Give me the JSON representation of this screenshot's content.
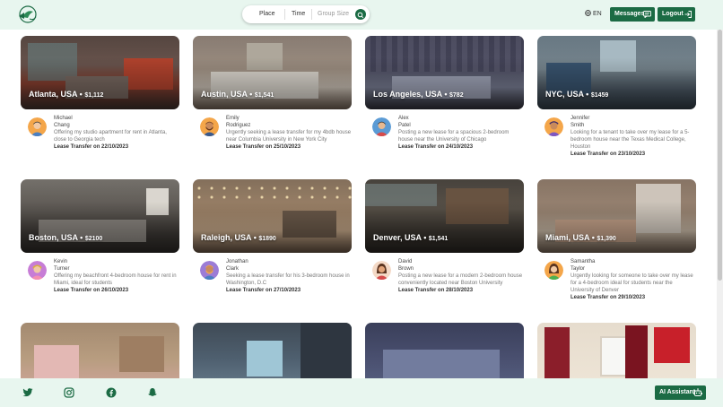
{
  "header": {
    "search": {
      "place": "Place",
      "time": "Time",
      "group_size": "Group Size"
    },
    "language": "EN",
    "messages_label": "Messages",
    "logout_label": "Logout"
  },
  "listings": [
    {
      "city": "Atlanta, USA",
      "price": "$1,112",
      "first_name": "Michael",
      "last_name": "Chang",
      "description": "Offering my studio apartment for rent in Atlanta, close to Georgia tech",
      "lease": "Lease Transfer on 22/10/2023"
    },
    {
      "city": "Austin, USA",
      "price": "$1,541",
      "first_name": "Emily",
      "last_name": "Rodriguez",
      "description": "Urgently seeking a lease transfer for my 4bdb house near Columbia University in New York City",
      "lease": "Lease Transfer on 25/10/2023"
    },
    {
      "city": "Los Angeles, USA",
      "price": "$782",
      "first_name": "Alex",
      "last_name": "Patel",
      "description": "Posting a new lease for a spacious 2-bedroom house near the University of Chicago",
      "lease": "Lease Transfer on 24/10/2023"
    },
    {
      "city": "NYC, USA",
      "price": "$1459",
      "first_name": "Jennifer",
      "last_name": "Smith",
      "description": "Looking for a tenant to take over my lease for a 5-bedroom house near the Texas Medical College, Houston",
      "lease": "Lease Transfer on 23/10/2023"
    },
    {
      "city": "Boston, USA",
      "price": "$2100",
      "first_name": "Kevin",
      "last_name": "Turner",
      "description": "Offering my beachfront 4-bedroom house for rent in Miami, ideal for students",
      "lease": "Lease Transfer on 26/10/2023"
    },
    {
      "city": "Raleigh, USA",
      "price": "$1890",
      "first_name": "Jonathan",
      "last_name": "Clark",
      "description": "Seeking a lease transfer for his 3-bedroom house in Washington, D.C",
      "lease": "Lease Transfer on 27/10/2023"
    },
    {
      "city": "Denver, USA",
      "price": "$1,541",
      "first_name": "David",
      "last_name": "Brown",
      "description": "Posting a new lease for a modern 2-bedroom house conveniently located near Boston University",
      "lease": "Lease Transfer on 28/10/2023"
    },
    {
      "city": "Miami, USA",
      "price": "$1,390",
      "first_name": "Samantha",
      "last_name": "Taylor",
      "description": "Urgently looking for someone to take over my lease for a 4-bedroom ideal for students near the University of Denver",
      "lease": "Lease Transfer on 29/10/2023"
    },
    {
      "city": "",
      "price": "",
      "first_name": "",
      "last_name": "",
      "description": "",
      "lease": ""
    },
    {
      "city": "",
      "price": "",
      "first_name": "",
      "last_name": "",
      "description": "",
      "lease": ""
    },
    {
      "city": "",
      "price": "",
      "first_name": "",
      "last_name": "",
      "description": "",
      "lease": ""
    },
    {
      "city": "",
      "price": "",
      "first_name": "",
      "last_name": "",
      "description": "",
      "lease": ""
    }
  ],
  "footer": {
    "social_icons": [
      "twitter-icon",
      "instagram-icon",
      "facebook-icon",
      "snapchat-icon"
    ],
    "ai_assistant_label": "AI Assistant"
  },
  "colors": {
    "brand_green": "#1b6b44",
    "header_bg": "#e8f6ef"
  }
}
